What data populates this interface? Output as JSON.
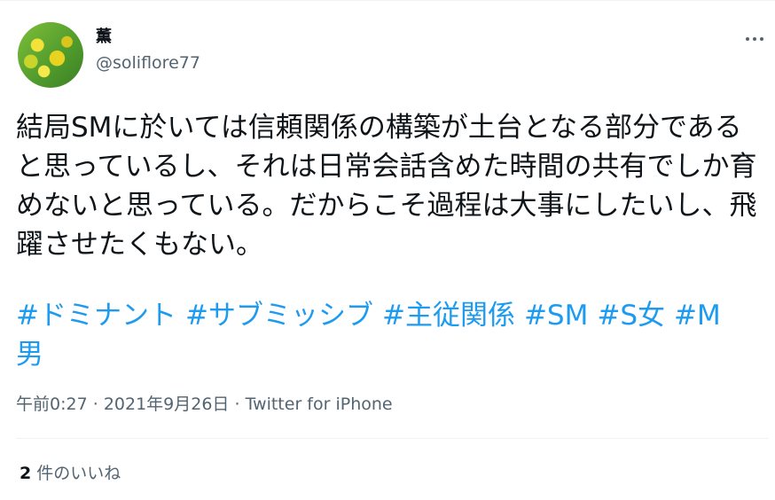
{
  "user": {
    "display_name": "薫",
    "handle": "@soliflore77"
  },
  "tweet": {
    "text": "結局SMに於いては信頼関係の構築が土台となる部分であると思っているし、それは日常会話含めた時間の共有でしか育めないと思っている。だからこそ過程は大事にしたいし、飛躍させたくもない。",
    "hashtags": [
      "#ドミナント",
      "#サブミッシブ",
      "#主従関係",
      "#SM",
      "#S女",
      "#M男"
    ]
  },
  "meta": {
    "time": "午前0:27",
    "separator": "·",
    "date": "2021年9月26日",
    "source": "Twitter for iPhone"
  },
  "stats": {
    "likes_count": "2",
    "likes_label": "件のいいね"
  },
  "icons": {
    "more": "more-dots-icon",
    "avatar": "avatar-image"
  },
  "colors": {
    "hashtag": "#1d9bf0",
    "secondary_text": "#536471",
    "primary_text": "#0f1419"
  }
}
